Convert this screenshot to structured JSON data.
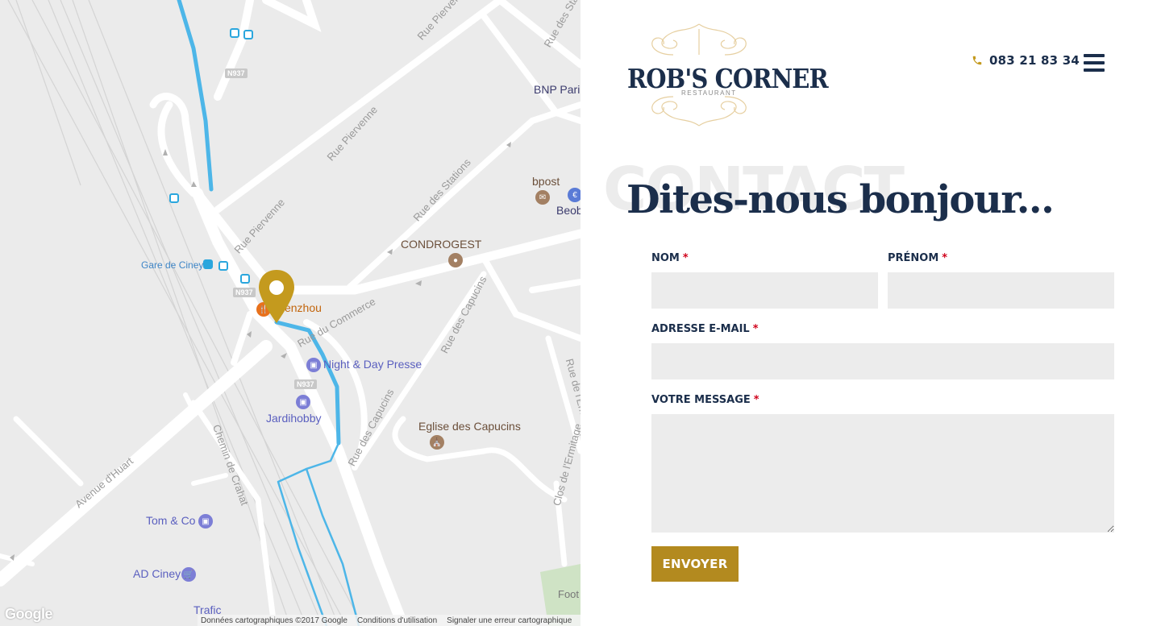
{
  "map": {
    "streets": {
      "rue_pierv_1": "Rue Piervenne",
      "rue_pierv_2": "Rue Piervenne",
      "rue_pierv_3": "Rue Piervenne",
      "rue_stations_1": "Rue des Stations",
      "rue_stations_2": "Rue des Stations",
      "rue_commerce": "Rue du Commerce",
      "rue_capucins_1": "Rue des Capucins",
      "rue_capucins_2": "Rue des Capucins",
      "rue_ermitage_1": "Rue de l'Ermitage",
      "clos_ermitage": "Clos de l'Ermitage",
      "avenue_huart": "Avenue d'Huart",
      "chemin_crahat": "Chemin de Crahat"
    },
    "road_shields": [
      "N937",
      "N937",
      "N937"
    ],
    "pois": {
      "bnp": "BNP Parib",
      "bpost": "bpost",
      "beob": "Beob",
      "condrogest": "CONDROGEST",
      "gare": "Gare de Ciney",
      "wenzhou": "Wenzhou",
      "night_day": "Night & Day Presse",
      "jardihobby": "Jardihobby",
      "eglise": "Eglise des Capucins",
      "tom_co": "Tom & Co",
      "ad_ciney": "AD Ciney",
      "foot": "Foot"
    },
    "trafic": "Trafic",
    "google_logo": "Google",
    "footer": {
      "data": "Données cartographiques ©2017 Google",
      "terms": "Conditions d'utilisation",
      "report": "Signaler une erreur cartographique"
    },
    "colors": {
      "background": "#ebebeb",
      "road": "#ffffff",
      "route": "#4db6e8",
      "marker": "#c49a1e"
    }
  },
  "header": {
    "logo_text": "ROB'S CORNER",
    "logo_sub": "RESTAURANT",
    "phone_icon": "phone-icon",
    "phone": "083 21 83 34",
    "menu_icon": "hamburger-menu-icon"
  },
  "contact": {
    "bg_word": "CONTACT",
    "heading": "Dites-nous bonjour...",
    "form": {
      "nom_label": "NOM",
      "prenom_label": "PRÉNOM",
      "email_label": "ADRESSE E-MAIL",
      "message_label": "VOTRE MESSAGE",
      "required_mark": "*",
      "nom_value": "",
      "prenom_value": "",
      "email_value": "",
      "message_value": "",
      "submit_label": "ENVOYER"
    }
  },
  "colors": {
    "navy": "#1b2e4b",
    "gold": "#b38a1f",
    "required": "#d0021b",
    "field_bg": "#ececec"
  }
}
